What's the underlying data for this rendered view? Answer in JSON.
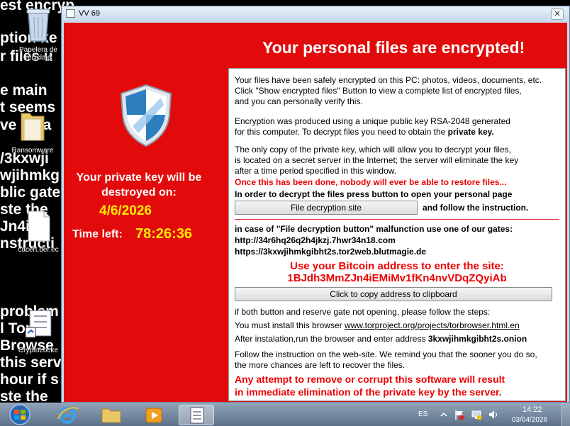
{
  "wallpaper": {
    "lines": [
      "est encryp",
      "ption ke",
      "r files u",
      "e main",
      "t seems",
      "ve to la",
      "/3kxwji",
      "wjihmkg",
      "blic gate",
      "ste the",
      "Jn4iMi",
      "nstructi",
      "problem",
      "l Tor b",
      "Browse",
      "this serv",
      "hour if s",
      "ste the"
    ]
  },
  "desktop_icons": [
    {
      "name": "recycle-bin",
      "label": "Papelera de reciclaje"
    },
    {
      "name": "ransomware-folder",
      "label": "Ransomware"
    },
    {
      "name": "cacert-file",
      "label": "cacert.der.ec"
    },
    {
      "name": "cryptolocker-shortcut",
      "label": "CryptoLocke"
    }
  ],
  "window": {
    "title": "VV 69",
    "close_glyph": "✕"
  },
  "ransom": {
    "headline": "Your personal files are encrypted!",
    "destroy_text": "Your private key will be destroyed on:",
    "date": "4/6/2026",
    "time_left_label": "Time left:",
    "time_left": "78:26:36"
  },
  "panel": {
    "p1_1": "Your files have been safely encrypted on this PC: photos, videos, documents, etc.",
    "p1_2": "Click \"Show encrypted files\" Button to view a complete list of encrypted files,",
    "p1_3": "and you can personally verify this.",
    "p2_1": "Encryption was produced using a unique public key RSA-2048 generated",
    "p2_2a": "for this computer. To decrypt files you need to obtain the ",
    "p2_2b": "private key.",
    "p3_1": "The only copy of the private key, which will allow you to decrypt your files,",
    "p3_2": "is located on a secret server in the Internet; the server will eliminate the key",
    "p3_3": "after a time period specified in this window.",
    "warn_red": "Once this has been done, nobody will ever be able to restore files...",
    "order": "In order to decrypt the files press button to open your personal page",
    "decrypt_button": "File decryption site",
    "follow": "and follow the instruction.",
    "malfunction": "in case of \"File decryption button\" malfunction use one of our gates:",
    "gate1": "http://34r6hq26q2h4jkzj.7hwr34n18.com",
    "gate2": "https://3kxwjihmkgibht2s.tor2web.blutmagie.de",
    "bitcoin_label": "Use your Bitcoin address to  enter the site:",
    "bitcoin_address": "1BJdh3MmZJn4iEMiMv1fKn4nvVDqZQyiAb",
    "copy_button": "Click to copy address to clipboard",
    "reserve": "if both button and reserve gate not opening, please follow the steps:",
    "install_a": "You must install this browser ",
    "install_link": "www.torproject.org/projects/torbrowser.html.en",
    "after_a": "After instalation,run the browser and enter address ",
    "after_b": "3kxwjihmkgibht2s.onion",
    "follow2_1": "Follow the instruction on the web-site. We remind you that the sooner you do so,",
    "follow2_2": "the more chances are left to recover the files.",
    "final_1": "Any attempt to remove or corrupt this software will result",
    "final_2": "in immediate elimination of the private key by the server."
  },
  "taskbar": {
    "language": "ES",
    "time": "14:22",
    "date": "03/04/2026",
    "apps": [
      "start-button",
      "internet-explorer",
      "windows-explorer",
      "media-player",
      "cryptolocker"
    ]
  },
  "colors": {
    "window_red": "#e20a0a",
    "timer_yellow": "#ffea00",
    "alert_red": "#e00000"
  }
}
